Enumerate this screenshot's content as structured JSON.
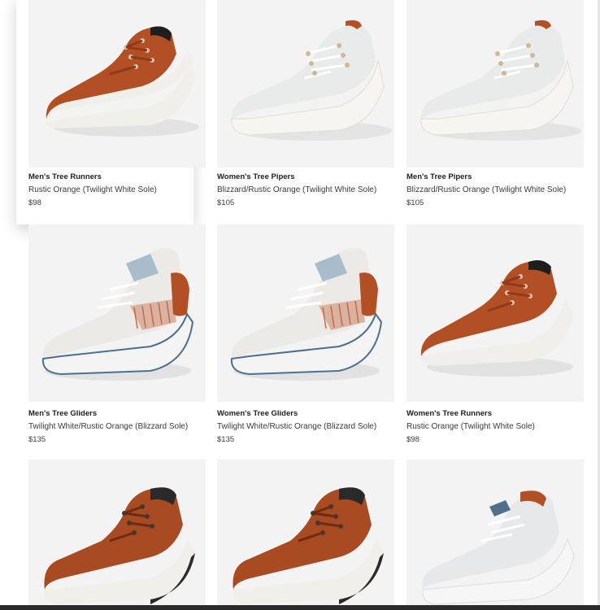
{
  "products": [
    {
      "name": "Men's Tree Runners",
      "variant": "Rustic Orange (Twilight White Sole)",
      "price": "$98",
      "icon": "runner-shoe-orange"
    },
    {
      "name": "Women's Tree Pipers",
      "variant": "Blizzard/Rustic Orange (Twilight White Sole)",
      "price": "$105",
      "icon": "piper-shoe-white"
    },
    {
      "name": "Men's Tree Pipers",
      "variant": "Blizzard/Rustic Orange (Twilight White Sole)",
      "price": "$105",
      "icon": "piper-shoe-white"
    },
    {
      "name": "Men's Tree Gliders",
      "variant": "Twilight White/Rustic Orange (Blizzard Sole)",
      "price": "$135",
      "icon": "glider-shoe"
    },
    {
      "name": "Women's Tree Gliders",
      "variant": "Twilight White/Rustic Orange (Blizzard Sole)",
      "price": "$135",
      "icon": "glider-shoe"
    },
    {
      "name": "Women's Tree Runners",
      "variant": "Rustic Orange (Twilight White Sole)",
      "price": "$98",
      "icon": "runner-shoe-orange"
    },
    {
      "name": "",
      "variant": "",
      "price": "",
      "icon": "runner-shoe-orange-dark"
    },
    {
      "name": "",
      "variant": "",
      "price": "",
      "icon": "runner-shoe-orange-dark"
    },
    {
      "name": "",
      "variant": "",
      "price": "",
      "icon": "runner-shoe-white-blue"
    }
  ],
  "colors": {
    "tile_bg": "#f3f3f3",
    "rustic_orange": "#b24f25",
    "blizzard": "#e9eaea",
    "sole_white": "#f1efe9",
    "accent_blue": "#4e6f8e"
  }
}
